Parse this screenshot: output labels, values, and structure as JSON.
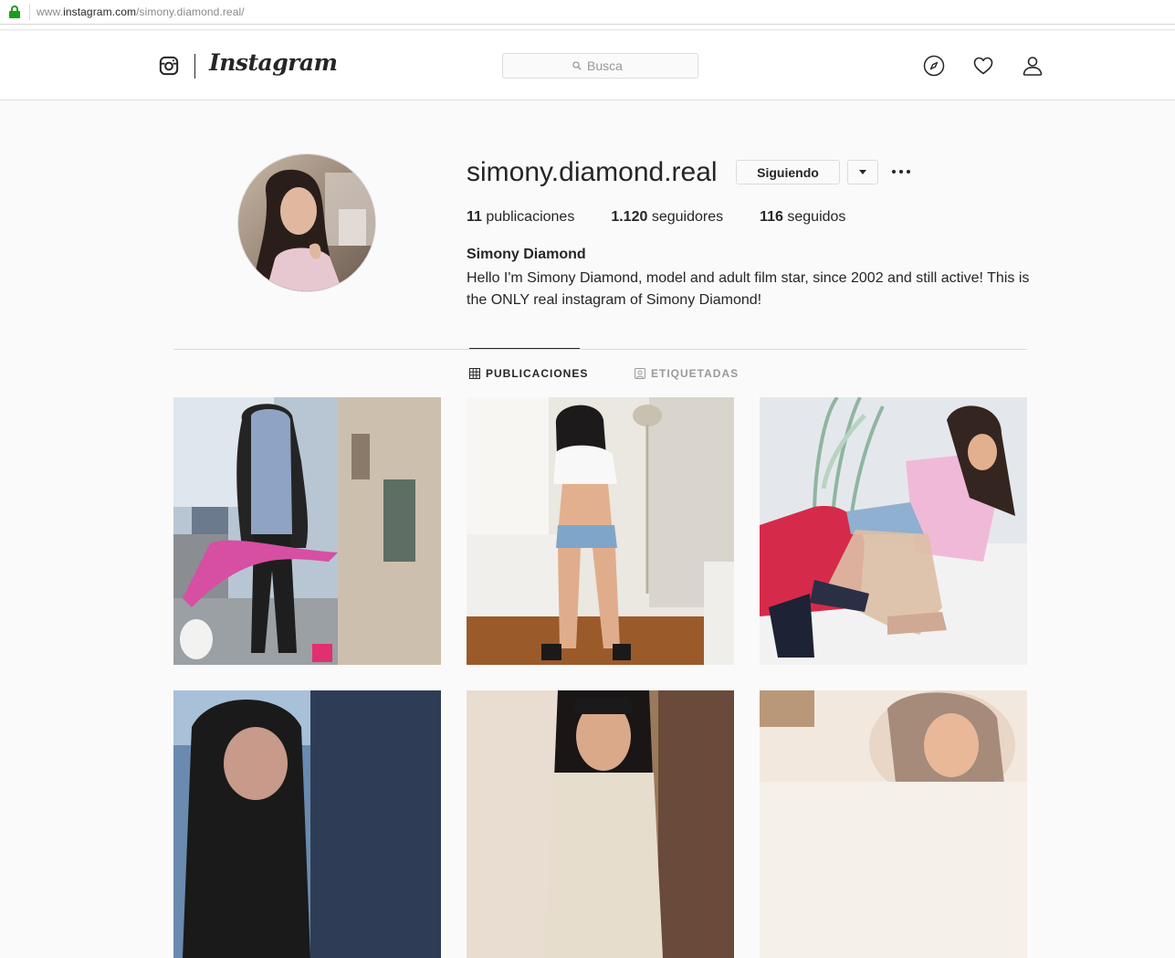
{
  "browser": {
    "url_prefix": "www.",
    "url_host": "instagram.com",
    "url_path": "/simony.diamond.real/"
  },
  "header": {
    "wordmark": "Instagram",
    "search_placeholder": "Busca",
    "icons": [
      "instagram-glyph-icon",
      "compass-icon",
      "heart-icon",
      "person-icon"
    ]
  },
  "profile": {
    "username": "simony.diamond.real",
    "follow_label": "Siguiendo",
    "stats": [
      {
        "count": "11",
        "label": "publicaciones"
      },
      {
        "count": "1.120",
        "label": "seguidores"
      },
      {
        "count": "116",
        "label": "seguidos"
      }
    ],
    "full_name": "Simony Diamond",
    "bio": "Hello I'm Simony Diamond, model and adult film star, since 2002 and still active! This is the ONLY real instagram of Simony Diamond!"
  },
  "tabs": [
    {
      "label": "PUBLICACIONES",
      "active": true,
      "icon": "grid-icon"
    },
    {
      "label": "ETIQUETADAS",
      "active": false,
      "icon": "tagged-icon"
    }
  ],
  "posts": [
    {
      "alt_theme": "street",
      "palette": [
        "#8fa3b8",
        "#6b7a8c",
        "#c9b8a4",
        "#d64fa3"
      ]
    },
    {
      "alt_theme": "living-room",
      "palette": [
        "#e8e4de",
        "#f4f2ef",
        "#9b5a2a",
        "#7fa6c9"
      ]
    },
    {
      "alt_theme": "sofa",
      "palette": [
        "#d9dde2",
        "#f1f1f1",
        "#d62a4a",
        "#e9b6d6"
      ]
    },
    {
      "alt_theme": "portrait",
      "palette": [
        "#5a7ea6",
        "#2a3a55",
        "#c79a8a",
        "#1a1a1a"
      ]
    },
    {
      "alt_theme": "portrait",
      "palette": [
        "#b08a6a",
        "#6a4a3a",
        "#e0d0c0",
        "#1a1a1a"
      ]
    },
    {
      "alt_theme": "portrait",
      "palette": [
        "#e0cfc0",
        "#f2e8de",
        "#b07a5a",
        "#6a4a3a"
      ]
    }
  ]
}
